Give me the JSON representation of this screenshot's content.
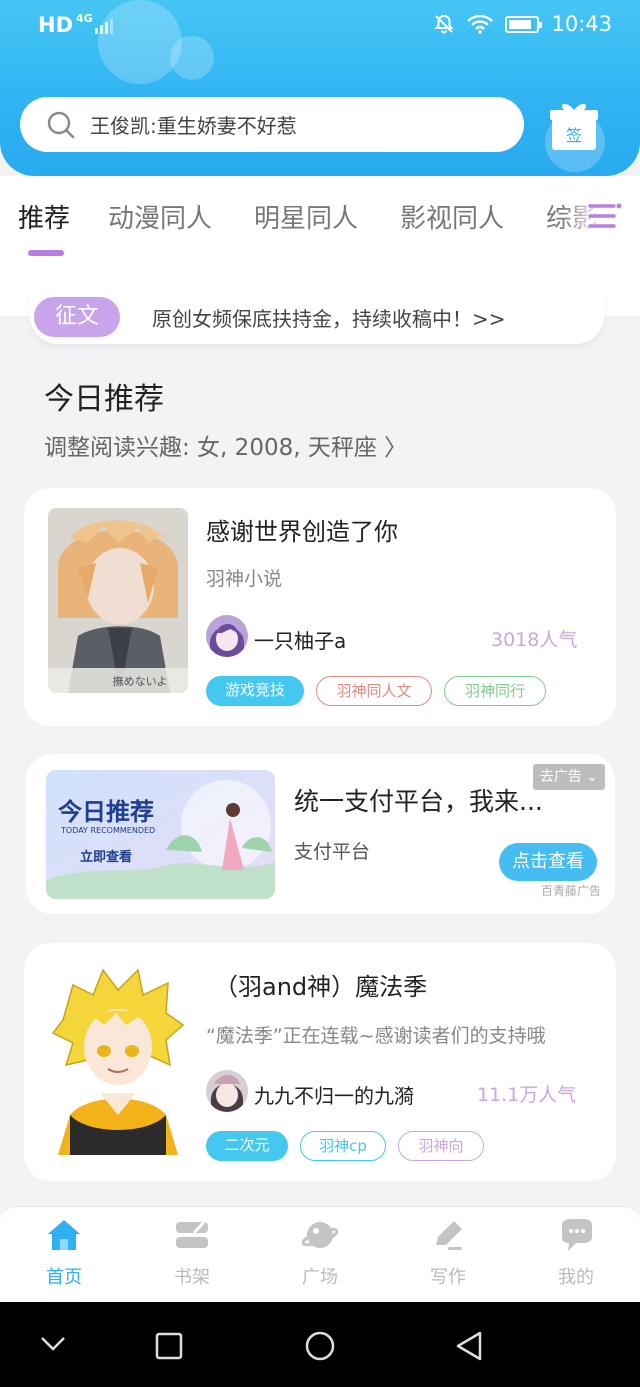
{
  "status_bar": {
    "left": "HD",
    "network": "4G",
    "time": "10:43"
  },
  "search": {
    "text": "王俊凯:重生娇妻不好惹"
  },
  "gift": {
    "label": "签"
  },
  "tabs": [
    {
      "label": "推荐",
      "active": true
    },
    {
      "label": "动漫同人"
    },
    {
      "label": "明星同人"
    },
    {
      "label": "影视同人"
    },
    {
      "label": "综影"
    }
  ],
  "notice": {
    "badge": "征文",
    "text": "原创女频保底扶持金，持续收稿中！>>"
  },
  "section": {
    "title": "今日推荐",
    "subtitle": "调整阅读兴趣: 女, 2008, 天秤座 〉"
  },
  "books": [
    {
      "title": "感谢世界创造了你",
      "subtitle": "羽神小说",
      "author": "一只柚子a",
      "popularity": "3018人气",
      "cover_caption": "撫めないよ",
      "tags": [
        {
          "label": "游戏竞技",
          "style": "filled",
          "color": "#45c8ef"
        },
        {
          "label": "羽神同人文",
          "style": "outline",
          "color": "#e68a80"
        },
        {
          "label": "羽神同行",
          "style": "outline",
          "color": "#7ccf8a"
        }
      ]
    },
    {
      "title": "（羽and神）魔法季",
      "subtitle": "“魔法季”正在连载~感谢读者们的支持哦",
      "author": "九九不归一的九漪",
      "popularity": "11.1万人气",
      "tags": [
        {
          "label": "二次元",
          "style": "filled",
          "color": "#45c8ef"
        },
        {
          "label": "羽神cp",
          "style": "outline",
          "color": "#45c8ef"
        },
        {
          "label": "羽神向",
          "style": "outline",
          "color": "#c9a6e6"
        }
      ]
    }
  ],
  "ad": {
    "banner_title": "今日推荐",
    "banner_en": "TODAY RECOMMENDED",
    "banner_cta": "立即查看",
    "title": "统一支付平台，我来...",
    "subtitle": "支付平台",
    "button": "点击查看",
    "close_label": "去广告 ⌄",
    "source": "百青藤广告"
  },
  "bottom_nav": [
    {
      "label": "首页",
      "icon": "home-icon",
      "active": true
    },
    {
      "label": "书架",
      "icon": "bookshelf-icon"
    },
    {
      "label": "广场",
      "icon": "planet-icon"
    },
    {
      "label": "写作",
      "icon": "pen-icon"
    },
    {
      "label": "我的",
      "icon": "chat-bubble-icon"
    }
  ],
  "colors": {
    "primary": "#2fb0f0",
    "accent_purple": "#b67fe0"
  }
}
